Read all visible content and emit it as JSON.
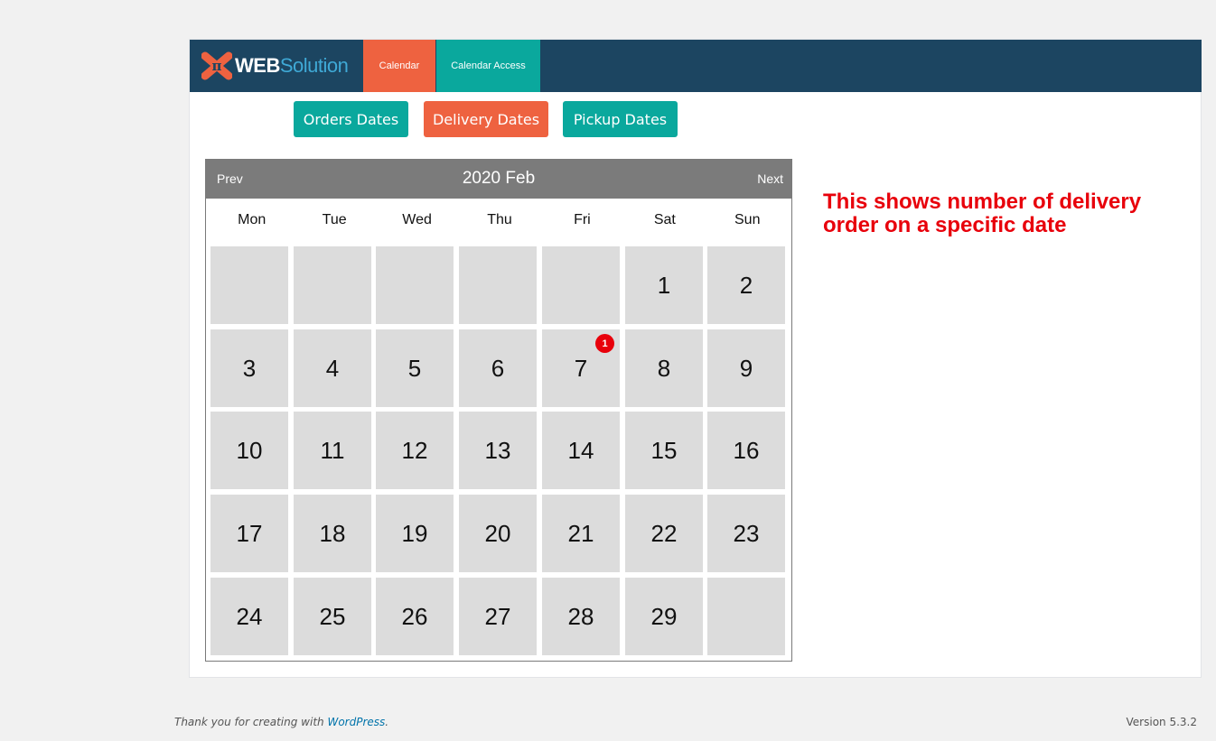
{
  "brand": {
    "logo_web": "WEB",
    "logo_solution": "Solution",
    "logo_glyph": "π",
    "accent_dark": "#1c4561",
    "accent_orange": "#ee6240",
    "accent_teal": "#0aa89d"
  },
  "nav": {
    "tabs": [
      {
        "label": "Calendar",
        "active": true
      },
      {
        "label": "Calendar Access",
        "active": false
      }
    ]
  },
  "filters": {
    "orders": "Orders Dates",
    "delivery": "Delivery Dates",
    "pickup": "Pickup Dates",
    "selected": "Delivery Dates"
  },
  "calendar": {
    "prev_label": "Prev",
    "next_label": "Next",
    "title": "2020 Feb",
    "weekdays": [
      "Mon",
      "Tue",
      "Wed",
      "Thu",
      "Fri",
      "Sat",
      "Sun"
    ],
    "weeks": [
      [
        "",
        "",
        "",
        "",
        "",
        "1",
        "2"
      ],
      [
        "3",
        "4",
        "5",
        "6",
        "7",
        "8",
        "9"
      ],
      [
        "10",
        "11",
        "12",
        "13",
        "14",
        "15",
        "16"
      ],
      [
        "17",
        "18",
        "19",
        "20",
        "21",
        "22",
        "23"
      ],
      [
        "24",
        "25",
        "26",
        "27",
        "28",
        "29",
        ""
      ]
    ],
    "badges": [
      {
        "day": "7",
        "count": "1"
      }
    ]
  },
  "annotation": "This shows number of delivery order on a specific date",
  "footer": {
    "thanks_prefix": "Thank you for creating with ",
    "thanks_link": "WordPress",
    "thanks_suffix": ".",
    "version": "Version 5.3.2"
  }
}
